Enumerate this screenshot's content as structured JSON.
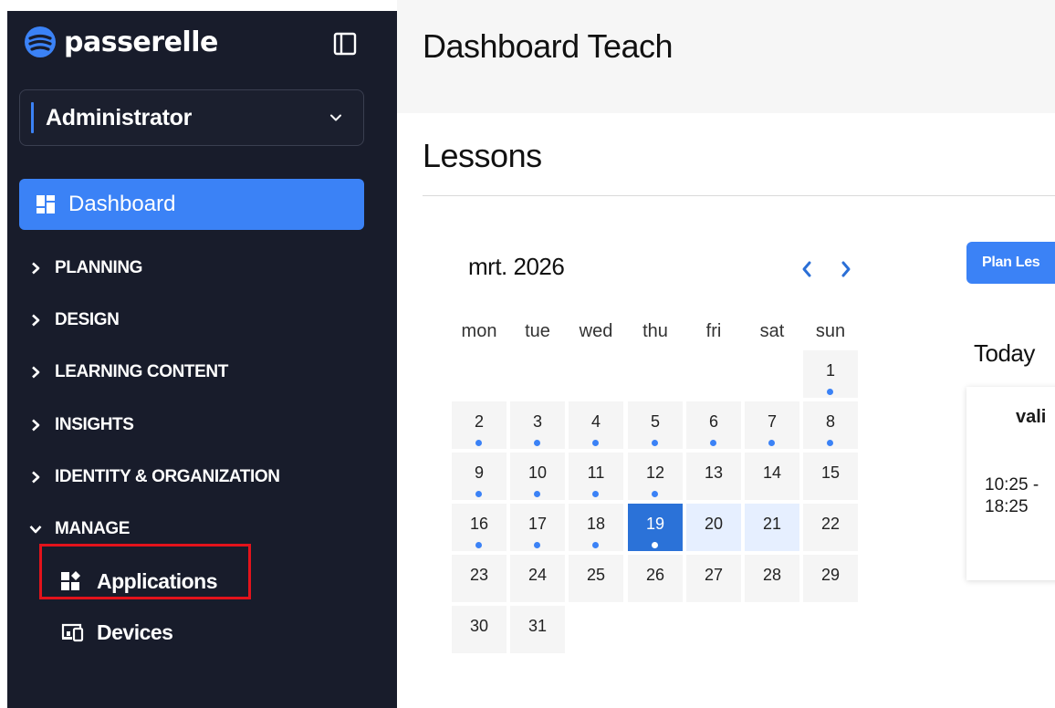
{
  "brand": {
    "name": "passerelle",
    "accent": "#3b82f6",
    "sidebar_bg": "#181c2b",
    "highlight": "#e3131b"
  },
  "sidebar": {
    "role": "Administrator",
    "active_item": {
      "label": "Dashboard",
      "icon": "dashboard-icon"
    },
    "sections": [
      {
        "label": "PLANNING",
        "expanded": false
      },
      {
        "label": "DESIGN",
        "expanded": false
      },
      {
        "label": "LEARNING CONTENT",
        "expanded": false
      },
      {
        "label": "INSIGHTS",
        "expanded": false
      },
      {
        "label": "IDENTITY & ORGANIZATION",
        "expanded": false
      },
      {
        "label": "MANAGE",
        "expanded": true
      }
    ],
    "manage_items": [
      {
        "label": "Applications",
        "icon": "applications-icon"
      },
      {
        "label": "Devices",
        "icon": "devices-icon"
      }
    ]
  },
  "header": {
    "title": "Dashboard Teach"
  },
  "lessons": {
    "title": "Lessons",
    "calendar": {
      "month_label": "mrt. 2026",
      "weekdays": [
        "mon",
        "tue",
        "wed",
        "thu",
        "fri",
        "sat",
        "sun"
      ],
      "days": [
        {
          "n": "1",
          "dot": true
        },
        {
          "n": "2",
          "dot": true
        },
        {
          "n": "3",
          "dot": true
        },
        {
          "n": "4",
          "dot": true
        },
        {
          "n": "5",
          "dot": true
        },
        {
          "n": "6",
          "dot": true
        },
        {
          "n": "7",
          "dot": true
        },
        {
          "n": "8",
          "dot": true
        },
        {
          "n": "9",
          "dot": true
        },
        {
          "n": "10",
          "dot": true
        },
        {
          "n": "11",
          "dot": true
        },
        {
          "n": "12",
          "dot": true
        },
        {
          "n": "13",
          "dot": false
        },
        {
          "n": "14",
          "dot": false
        },
        {
          "n": "15",
          "dot": false
        },
        {
          "n": "16",
          "dot": true
        },
        {
          "n": "17",
          "dot": true
        },
        {
          "n": "18",
          "dot": true
        },
        {
          "n": "19",
          "dot": true,
          "state": "today"
        },
        {
          "n": "20",
          "dot": false,
          "state": "range"
        },
        {
          "n": "21",
          "dot": false,
          "state": "range"
        },
        {
          "n": "22",
          "dot": false
        },
        {
          "n": "23",
          "dot": false
        },
        {
          "n": "24",
          "dot": false
        },
        {
          "n": "25",
          "dot": false
        },
        {
          "n": "26",
          "dot": false
        },
        {
          "n": "27",
          "dot": false
        },
        {
          "n": "28",
          "dot": false
        },
        {
          "n": "29",
          "dot": false
        },
        {
          "n": "30",
          "dot": false
        },
        {
          "n": "31",
          "dot": false
        }
      ]
    },
    "plan_button": "Plan Les",
    "today_title": "Today",
    "card": {
      "name": "vali",
      "time_start": "10:25 -",
      "time_end": "18:25"
    }
  }
}
